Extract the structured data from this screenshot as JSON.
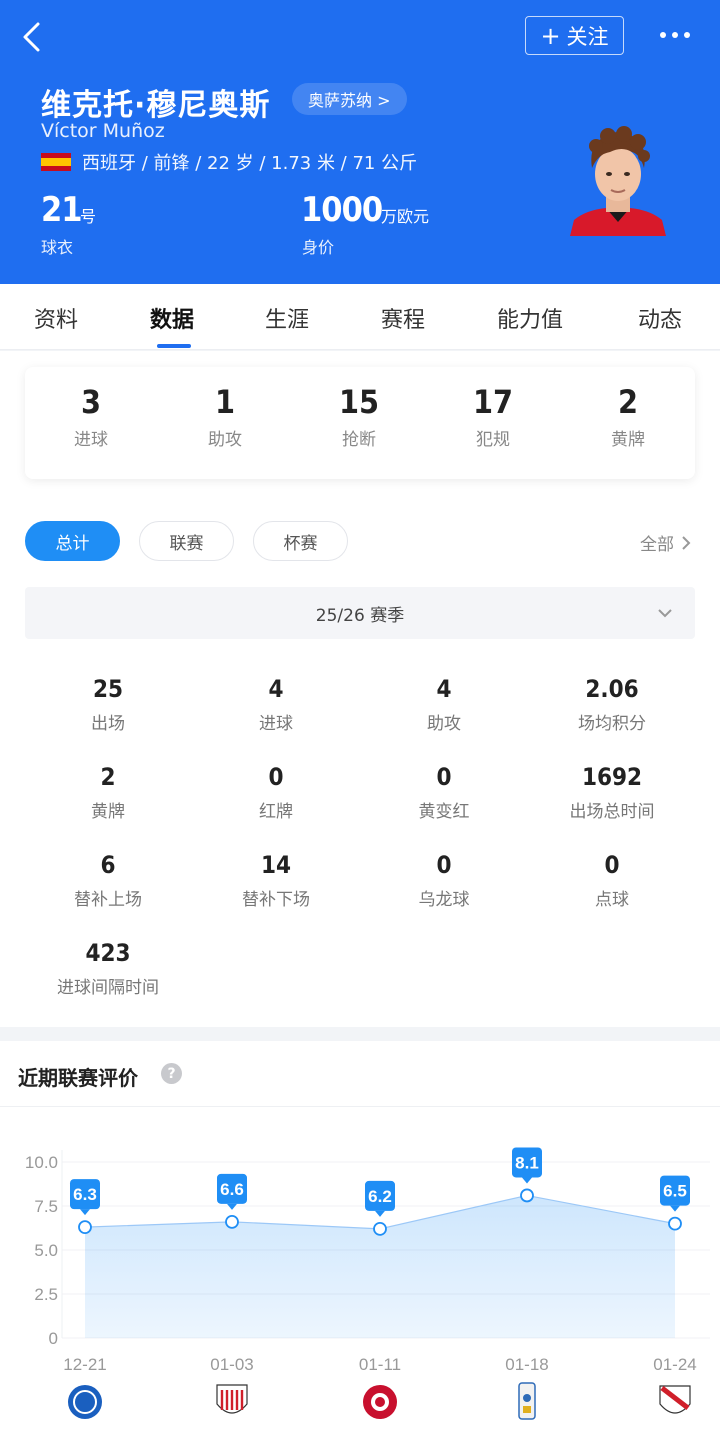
{
  "header": {
    "follow_label": "关注",
    "name_cn": "维克托·穆尼奥斯",
    "club_label": "奥萨苏纳 >",
    "name_latin": "Víctor Muñoz",
    "nationality": "西班牙",
    "info": "西班牙 / 前锋 / 22 岁 / 1.73 米 / 71 公斤",
    "shirt_number": "21",
    "shirt_unit": "号",
    "shirt_label": "球衣",
    "value": "1000",
    "value_unit": "万欧元",
    "value_label": "身价"
  },
  "tabs": [
    "资料",
    "数据",
    "生涯",
    "赛程",
    "能力值",
    "动态"
  ],
  "active_tab": "数据",
  "summary": [
    {
      "value": "3",
      "label": "进球"
    },
    {
      "value": "1",
      "label": "助攻"
    },
    {
      "value": "15",
      "label": "抢断"
    },
    {
      "value": "17",
      "label": "犯规"
    },
    {
      "value": "2",
      "label": "黄牌"
    }
  ],
  "filters": [
    "总计",
    "联赛",
    "杯赛"
  ],
  "active_filter": "总计",
  "all_label": "全部",
  "season_label": "25/26 赛季",
  "grid_stats": [
    {
      "value": "25",
      "label": "出场"
    },
    {
      "value": "4",
      "label": "进球"
    },
    {
      "value": "4",
      "label": "助攻"
    },
    {
      "value": "2.06",
      "label": "场均积分"
    },
    {
      "value": "2",
      "label": "黄牌"
    },
    {
      "value": "0",
      "label": "红牌"
    },
    {
      "value": "0",
      "label": "黄变红"
    },
    {
      "value": "1692",
      "label": "出场总时间"
    },
    {
      "value": "6",
      "label": "替补上场"
    },
    {
      "value": "14",
      "label": "替补下场"
    },
    {
      "value": "0",
      "label": "乌龙球"
    },
    {
      "value": "0",
      "label": "点球"
    },
    {
      "value": "423",
      "label": "进球间隔时间"
    }
  ],
  "rating_title": "近期联赛评价",
  "chart_data": {
    "type": "area",
    "x": [
      "12-21",
      "01-03",
      "01-11",
      "01-18",
      "01-24"
    ],
    "values": [
      6.3,
      6.6,
      6.2,
      8.1,
      6.5
    ],
    "yticks": [
      "10.0",
      "7.5",
      "5.0",
      "2.5",
      "0"
    ],
    "ylim": [
      0,
      10
    ],
    "color": "#1f8ef5",
    "opponents": [
      "Alavés",
      "Athletic Club",
      "Girona",
      "Real Oviedo",
      "Rayo Vallecano"
    ]
  }
}
